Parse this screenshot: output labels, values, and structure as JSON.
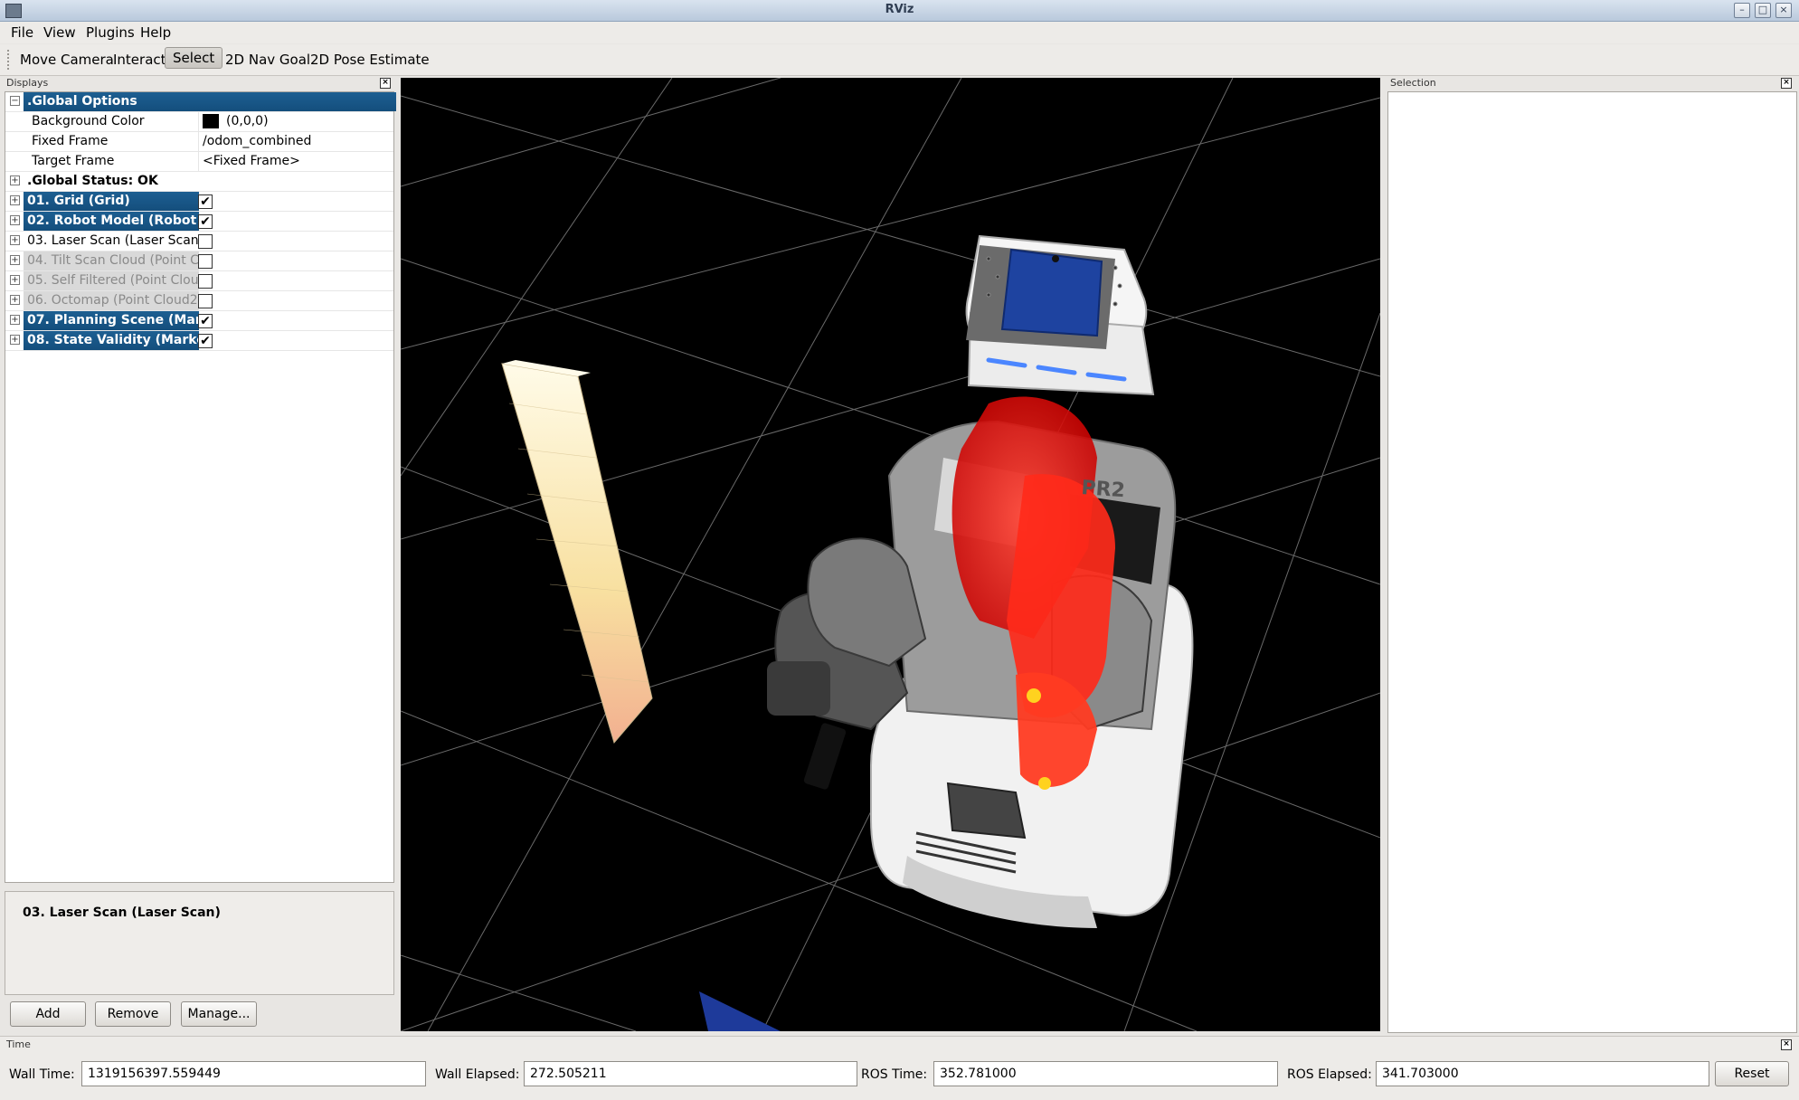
{
  "window": {
    "title": "RViz"
  },
  "menu": [
    {
      "label": "File"
    },
    {
      "label": "View"
    },
    {
      "label": "Plugins"
    },
    {
      "label": "Help"
    }
  ],
  "toolbar": [
    {
      "label": "Move Camera"
    },
    {
      "label": "Interact"
    },
    {
      "label": "Select",
      "active": true
    },
    {
      "label": "2D Nav Goal"
    },
    {
      "label": "2D Pose Estimate"
    }
  ],
  "displays": {
    "title": "Displays",
    "global_options": {
      "label": ".Global Options",
      "background_color": {
        "label": "Background Color",
        "value": "(0,0,0)",
        "color": "#000000"
      },
      "fixed_frame": {
        "label": "Fixed Frame",
        "value": "/odom_combined"
      },
      "target_frame": {
        "label": "Target Frame",
        "value": "<Fixed Frame>"
      }
    },
    "global_status": ".Global Status: OK",
    "items": [
      {
        "label": "01. Grid (Grid)",
        "enabled": true,
        "state": "selected"
      },
      {
        "label": "02. Robot Model (Robot",
        "enabled": true,
        "state": "selected"
      },
      {
        "label": "03. Laser Scan (Laser Scan)",
        "enabled": false,
        "state": "normal"
      },
      {
        "label": "04. Tilt Scan Cloud (Point Cl",
        "enabled": false,
        "state": "disabled"
      },
      {
        "label": "05. Self Filtered (Point Clouc",
        "enabled": false,
        "state": "disabled"
      },
      {
        "label": "06. Octomap (Point Cloud2)",
        "enabled": false,
        "state": "disabled"
      },
      {
        "label": "07. Planning Scene (Mar",
        "enabled": true,
        "state": "selected"
      },
      {
        "label": "08. State Validity (Marke",
        "enabled": true,
        "state": "selected"
      }
    ],
    "help_text": "03. Laser Scan (Laser Scan)",
    "buttons": {
      "add": "Add",
      "remove": "Remove",
      "manage": "Manage..."
    }
  },
  "viewport": {
    "robot_label": "PR2"
  },
  "selection": {
    "title": "Selection"
  },
  "time": {
    "title": "Time",
    "wall_time_label": "Wall Time:",
    "wall_time": "1319156397.559449",
    "wall_elapsed_label": "Wall Elapsed:",
    "wall_elapsed": "272.505211",
    "ros_time_label": "ROS Time:",
    "ros_time": "352.781000",
    "ros_elapsed_label": "ROS Elapsed:",
    "ros_elapsed": "341.703000",
    "reset_label": "Reset"
  }
}
